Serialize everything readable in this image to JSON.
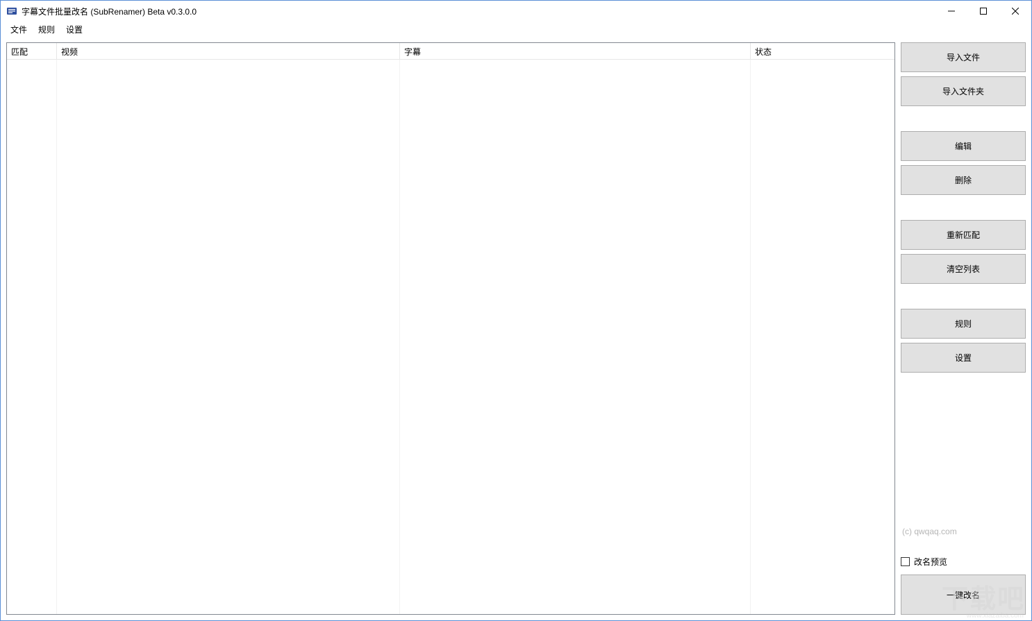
{
  "title": "字幕文件批量改名 (SubRenamer) Beta v0.3.0.0",
  "menu": {
    "file": "文件",
    "rule": "规则",
    "settings": "设置"
  },
  "columns": {
    "match": "匹配",
    "video": "视频",
    "subtitle": "字幕",
    "status": "状态"
  },
  "buttons": {
    "import_file": "导入文件",
    "import_folder": "导入文件夹",
    "edit": "编辑",
    "delete": "删除",
    "rematch": "重新匹配",
    "clear_list": "清空列表",
    "rule": "规则",
    "settings": "设置",
    "one_click_rename": "一键改名"
  },
  "preview_label": "改名预览",
  "copyright": "(c) qwqaq.com",
  "watermark": "下载吧",
  "watermark_sub": "www.xiazaiba.com"
}
